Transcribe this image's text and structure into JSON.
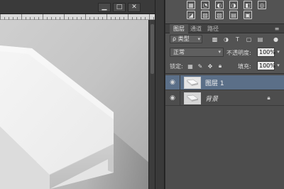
{
  "window_controls": {
    "minimize": "▁",
    "maximize": "□",
    "close": "✕"
  },
  "adjustments": {
    "icons": [
      "levels-icon",
      "curves-icon",
      "exposure-icon",
      "hue-icon",
      "black-white-icon",
      "channel-mixer-icon",
      "color-lookup-icon",
      "invert-icon",
      "posterize-icon",
      "threshold-icon",
      "gradient-map-icon",
      "selective-color-icon"
    ]
  },
  "panel": {
    "tabs": [
      {
        "label": "图层",
        "active": true
      },
      {
        "label": "通道",
        "active": false
      },
      {
        "label": "路径",
        "active": false
      }
    ],
    "menu_glyph": "≡"
  },
  "filter": {
    "kind_label": "ρ 类型"
  },
  "blend": {
    "mode": "正常",
    "opacity_label": "不透明度:",
    "opacity_value": "100%"
  },
  "lock": {
    "label": "锁定:",
    "fill_label": "填充:",
    "fill_value": "100%"
  },
  "layers": [
    {
      "name": "图层 1",
      "selected": true,
      "visible": true,
      "locked": false,
      "italic": false
    },
    {
      "name": "背景",
      "selected": false,
      "visible": true,
      "locked": true,
      "italic": true
    }
  ],
  "colors": {
    "panel_bg": "#535353",
    "selected_layer": "#5b6f88",
    "app_bg": "#282828"
  }
}
